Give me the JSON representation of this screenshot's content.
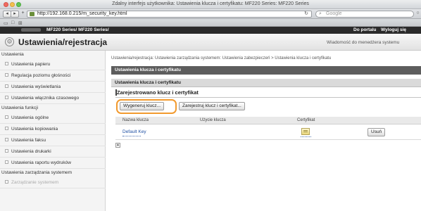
{
  "window": {
    "title": "Zdalny interfejs użytkownika: Ustawienia klucza i certyfikatu: MF220 Series: MF220 Series"
  },
  "toolbar": {
    "back_icon": "back-arrow-icon",
    "forward_icon": "forward-arrow-icon",
    "add_label": "+",
    "url": "http://192.168.0.215/m_security_key.html",
    "reload_icon": "reload-icon",
    "search_placeholder": "Google"
  },
  "appbar": {
    "model": "MF220 Series/ MF220 Series/",
    "portal_label": "Do portalu",
    "logout_label": "Wyloguj się"
  },
  "header": {
    "page_title": "Ustawienia/rejestracja",
    "message_link": "Wiadomość do menedżera systemu"
  },
  "sidebar": {
    "section_settings": "Ustawienia",
    "section_functions": "Ustawienia funkcji",
    "section_management": "Ustawienia zarządzania systemem",
    "items": [
      {
        "label": "Ustawienia papieru"
      },
      {
        "label": "Regulacja poziomu głośności"
      },
      {
        "label": "Ustawienia wyświetlania"
      },
      {
        "label": "Ustawienia włącznika czasowego"
      },
      {
        "label": "Ustawienia ogólne"
      },
      {
        "label": "Ustawienia kopiowania"
      },
      {
        "label": "Ustawienia faksu"
      },
      {
        "label": "Ustawienia drukarki"
      },
      {
        "label": "Ustawienia raportu wydruków"
      },
      {
        "label": "Zarządzanie systemem"
      }
    ]
  },
  "main": {
    "breadcrumb": "Ustawienia/rejestracja: Ustawienia zarządzania systemem: Ustawienia zabezpieczeń > Ustawienia klucza i certyfikatu",
    "dark_bar": "Ustawienia klucza i certyfikatu",
    "light_bar": "Ustawienia klucza i certyfikatu",
    "section_title": "Zarejestrowano klucz i certyfikat",
    "generate_button": "Wygeneruj klucz...",
    "register_button": "Zarejestruj klucz i certyfikat...",
    "columns": [
      "Nazwa klucza",
      "Użycie klucza",
      "Certyfikat"
    ],
    "rows": [
      {
        "key_name": "Default Key",
        "usage": "",
        "certificate_icon": "certificate-icon",
        "delete_label": "Usuń"
      }
    ],
    "scroll_top_icon": "arrow-up-icon"
  }
}
